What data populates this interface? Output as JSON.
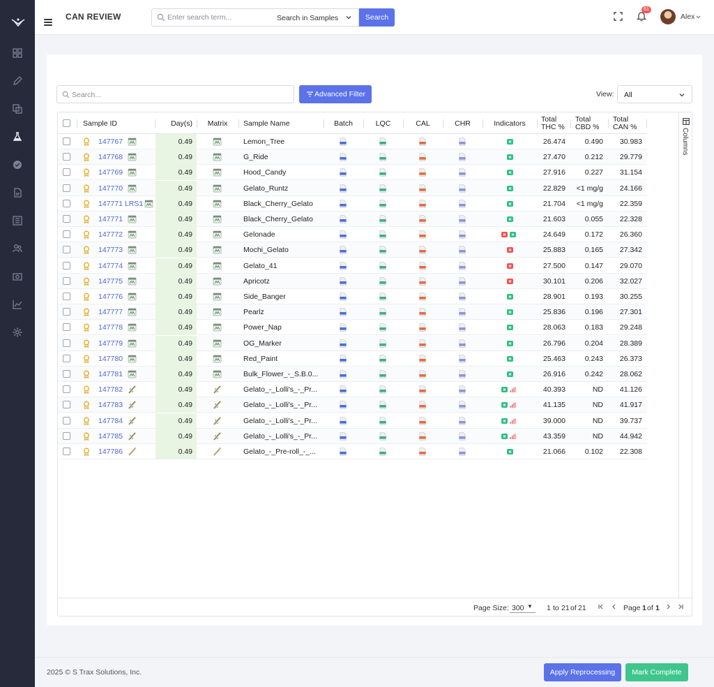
{
  "header": {
    "title": "CAN REVIEW",
    "search_placeholder": "Enter search term...",
    "search_scope": "Search in Samples",
    "search_button": "Search",
    "notification_count": "61",
    "user_name": "Alex"
  },
  "sidebar": {
    "items": [
      "dashboard-icon",
      "pencil-icon",
      "copy-icon",
      "flask-icon",
      "badge-check-icon",
      "document-icon",
      "list-icon",
      "users-icon",
      "camera-icon",
      "chart-icon",
      "settings-icon"
    ],
    "active": "flask-icon"
  },
  "toolbar": {
    "search_placeholder": "Search...",
    "advanced_filter": "Advanced Filter",
    "view_label": "View:",
    "view_value": "All"
  },
  "grid": {
    "columns": {
      "sample_id": "Sample ID",
      "days": "Day(s)",
      "matrix": "Matrix",
      "sample_name": "Sample Name",
      "batch": "Batch",
      "lqc": "LQC",
      "cal": "CAL",
      "chr": "CHR",
      "indicators": "Indicators",
      "thc_1": "Total",
      "thc_2": "THC %",
      "cbd_1": "Total",
      "cbd_2": "CBD %",
      "can_1": "Total",
      "can_2": "CAN %"
    },
    "columns_panel": "Columns",
    "rows": [
      {
        "id": "147767",
        "days": "0.49",
        "matrix": "flower",
        "name": "Lemon_Tree",
        "ind": [
          "g"
        ],
        "thc": "26.474",
        "cbd": "0.490",
        "can": "30.983"
      },
      {
        "id": "147768",
        "days": "0.49",
        "matrix": "flower",
        "name": "G_Ride",
        "ind": [
          "g"
        ],
        "thc": "27.470",
        "cbd": "0.212",
        "can": "29.779"
      },
      {
        "id": "147769",
        "days": "0.49",
        "matrix": "flower",
        "name": "Hood_Candy",
        "ind": [
          "g"
        ],
        "thc": "27.916",
        "cbd": "0.227",
        "can": "31.154"
      },
      {
        "id": "147770",
        "days": "0.49",
        "matrix": "flower",
        "name": "Gelato_Runtz",
        "ind": [
          "g"
        ],
        "thc": "22.829",
        "cbd": "<1 mg/g",
        "can": "24.166"
      },
      {
        "id": "147771 LRS1",
        "days": "0.49",
        "matrix": "flower",
        "name": "Black_Cherry_Gelato",
        "ind": [
          "g"
        ],
        "thc": "21.704",
        "cbd": "<1 mg/g",
        "can": "22.359"
      },
      {
        "id": "147771",
        "days": "0.49",
        "matrix": "flower",
        "name": "Black_Cherry_Gelato",
        "ind": [
          "g"
        ],
        "thc": "21.603",
        "cbd": "0.055",
        "can": "22.328"
      },
      {
        "id": "147772",
        "days": "0.49",
        "matrix": "flower",
        "name": "Gelonade",
        "ind": [
          "r",
          "g"
        ],
        "thc": "24.649",
        "cbd": "0.172",
        "can": "26.360"
      },
      {
        "id": "147773",
        "days": "0.49",
        "matrix": "flower",
        "name": "Mochi_Gelato",
        "ind": [
          "r"
        ],
        "thc": "25.883",
        "cbd": "0.165",
        "can": "27.342"
      },
      {
        "id": "147774",
        "days": "0.49",
        "matrix": "flower",
        "name": "Gelato_41",
        "ind": [
          "r"
        ],
        "thc": "27.500",
        "cbd": "0.147",
        "can": "29.070"
      },
      {
        "id": "147775",
        "days": "0.49",
        "matrix": "flower",
        "name": "Apricotz",
        "ind": [
          "r"
        ],
        "thc": "30.101",
        "cbd": "0.206",
        "can": "32.027"
      },
      {
        "id": "147776",
        "days": "0.49",
        "matrix": "flower",
        "name": "Side_Banger",
        "ind": [
          "g"
        ],
        "thc": "28.901",
        "cbd": "0.193",
        "can": "30.255"
      },
      {
        "id": "147777",
        "days": "0.49",
        "matrix": "flower",
        "name": "Pearlz",
        "ind": [
          "g"
        ],
        "thc": "25.836",
        "cbd": "0.196",
        "can": "27.301"
      },
      {
        "id": "147778",
        "days": "0.49",
        "matrix": "flower",
        "name": "Power_Nap",
        "ind": [
          "g"
        ],
        "thc": "28.063",
        "cbd": "0.183",
        "can": "29.248"
      },
      {
        "id": "147779",
        "days": "0.49",
        "matrix": "flower",
        "name": "OG_Marker",
        "ind": [
          "g"
        ],
        "thc": "26.796",
        "cbd": "0.204",
        "can": "28.389"
      },
      {
        "id": "147780",
        "days": "0.49",
        "matrix": "flower",
        "name": "Red_Paint",
        "ind": [
          "g"
        ],
        "thc": "25.463",
        "cbd": "0.243",
        "can": "26.373"
      },
      {
        "id": "147781",
        "days": "0.49",
        "matrix": "flower",
        "name": "Bulk_Flower_-_S.B.0...",
        "ind": [
          "g"
        ],
        "thc": "26.916",
        "cbd": "0.242",
        "can": "28.062"
      },
      {
        "id": "147782",
        "days": "0.49",
        "matrix": "preroll",
        "name": "Gelato_-_Lolli's_-_Pr...",
        "ind": [
          "g",
          "bars"
        ],
        "thc": "40.393",
        "cbd": "ND",
        "can": "41.126"
      },
      {
        "id": "147783",
        "days": "0.49",
        "matrix": "preroll",
        "name": "Gelato_-_Lolli's_-_Pr...",
        "ind": [
          "g",
          "bars"
        ],
        "thc": "41.135",
        "cbd": "ND",
        "can": "41.917"
      },
      {
        "id": "147784",
        "days": "0.49",
        "matrix": "preroll",
        "name": "Gelato_-_Lolli's_-_Pr...",
        "ind": [
          "g",
          "bars"
        ],
        "thc": "39.000",
        "cbd": "ND",
        "can": "39.737"
      },
      {
        "id": "147785",
        "days": "0.49",
        "matrix": "preroll",
        "name": "Gelato_-_Lolli's_-_Pr...",
        "ind": [
          "g",
          "bars"
        ],
        "thc": "43.359",
        "cbd": "ND",
        "can": "44.942"
      },
      {
        "id": "147786",
        "days": "0.49",
        "matrix": "joint",
        "name": "Gelato_-_Pre-roll_-_...",
        "ind": [
          "g"
        ],
        "thc": "21.066",
        "cbd": "0.102",
        "can": "22.308"
      }
    ],
    "footer": {
      "page_size_label": "Page Size:",
      "page_size": "300",
      "range_from": "1",
      "range_to_word": "to",
      "range_to": "21",
      "of_word": "of",
      "total": "21",
      "page_word": "Page",
      "page": "1",
      "page_of": "of",
      "pages": "1"
    }
  },
  "footer": {
    "copyright": "2025 © S Trax Solutions, Inc.",
    "apply_reprocessing": "Apply Reprocessing",
    "mark_complete": "Mark Complete"
  },
  "colors": {
    "accent": "#5b72e8",
    "success": "#3ec68d",
    "sidebar": "#262a3b",
    "link": "#4b66d9",
    "days_bg": "#e8f5e3",
    "batch_file": "#4a6fd8",
    "lqc_file": "#3bb07a",
    "cal_file": "#e56b3d",
    "chr_file": "#8c95d8",
    "indicator_green": "#2fbf83",
    "indicator_red": "#ef5350"
  }
}
